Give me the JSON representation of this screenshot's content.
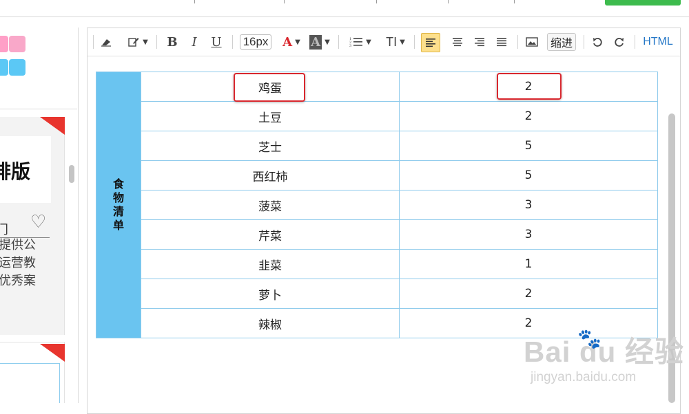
{
  "toolbar": {
    "bold": "B",
    "italic": "I",
    "underline": "U",
    "font_size": "16px",
    "font_color_glyph": "A",
    "bg_color_glyph": "A",
    "line_height_glyph": "TI",
    "indent_label": "缩进",
    "html_label": "HTML",
    "font_color": "#d9272e"
  },
  "left_panel": {
    "card_title_partial": "排版",
    "card_sub_partial": "门",
    "card_lines": [
      "提供公",
      "运营教",
      "优秀案"
    ],
    "swatch_colors": [
      "#f9a8c9",
      "#5bc8f5",
      "#ff9fc7"
    ]
  },
  "table": {
    "header": "食物清单",
    "rows": [
      {
        "name": "鸡蛋",
        "qty": "2"
      },
      {
        "name": "土豆",
        "qty": "2"
      },
      {
        "name": "芝士",
        "qty": "5"
      },
      {
        "name": "西红柿",
        "qty": "5"
      },
      {
        "name": "菠菜",
        "qty": "3"
      },
      {
        "name": "芹菜",
        "qty": "3"
      },
      {
        "name": "韭菜",
        "qty": "1"
      },
      {
        "name": "萝卜",
        "qty": "2"
      },
      {
        "name": "辣椒",
        "qty": "2"
      }
    ],
    "highlight_color": "#d9272e",
    "header_color": "#6ac4f0"
  },
  "watermark": {
    "brand": "Bai du 经验",
    "url": "jingyan.baidu.com"
  }
}
